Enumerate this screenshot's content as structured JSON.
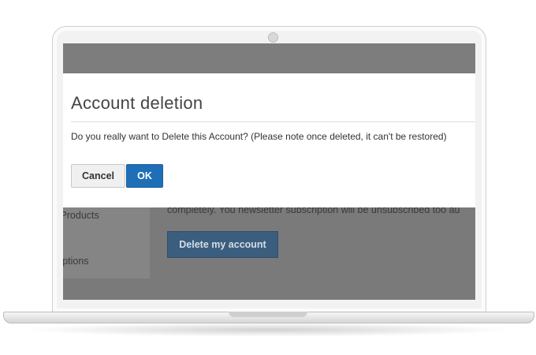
{
  "dialog": {
    "title": "Account deletion",
    "message": "Do you really want to Delete this Account? (Please note once deleted, it can't be restored)",
    "cancel_label": "Cancel",
    "ok_label": "OK"
  },
  "background": {
    "sidebar_items": [
      "e Products",
      "criptions"
    ],
    "info_text": "completely. You newsletter subscription will be unsubscribed too au",
    "delete_button_label": "Delete my account"
  },
  "colors": {
    "ok_button": "#1f6fb7",
    "overlay": "#7a7a7a",
    "delete_button": "#3b5e7f"
  }
}
